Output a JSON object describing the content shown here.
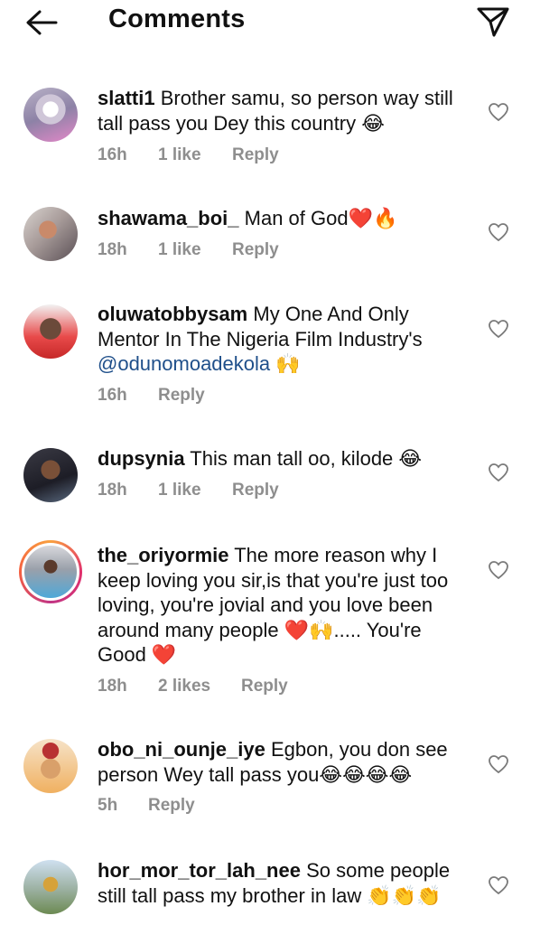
{
  "header": {
    "title": "Comments",
    "back_icon": "arrow-left-icon",
    "share_icon": "paper-plane-icon"
  },
  "comments": [
    {
      "username": "slatti1",
      "text": "Brother samu, so person way still tall pass you Dey this country 😂",
      "time": "16h",
      "likes": "1 like",
      "reply": "Reply"
    },
    {
      "username": "shawama_boi_",
      "text": "Man of God❤️🔥",
      "time": "18h",
      "likes": "1 like",
      "reply": "Reply"
    },
    {
      "username": "oluwatobbysam",
      "text": "My One And Only Mentor In The Nigeria Film Industry's",
      "mention": "@odunomoadekola",
      "text_after": " 🙌",
      "time": "16h",
      "reply": "Reply"
    },
    {
      "username": "dupsynia",
      "text": "This man tall oo, kilode 😂",
      "time": "18h",
      "likes": "1 like",
      "reply": "Reply"
    },
    {
      "username": "the_oriyormie",
      "text": "The more reason why I keep loving you sir,is that you're just too loving, you're jovial and you love been around many people ❤️🙌..... You're Good ❤️",
      "time": "18h",
      "likes": "2 likes",
      "reply": "Reply"
    },
    {
      "username": "obo_ni_ounje_iye",
      "text": "Egbon, you don see person Wey tall pass you😂😂😂😂",
      "time": "5h",
      "reply": "Reply"
    },
    {
      "username": "hor_mor_tor_lah_nee",
      "text": "So some people still tall pass my brother in law 👏👏👏",
      "time": "",
      "reply": ""
    }
  ]
}
